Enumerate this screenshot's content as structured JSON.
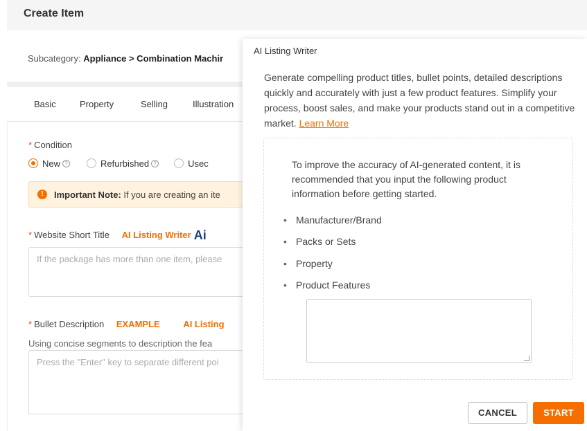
{
  "page": {
    "title": "Create Item",
    "subcategory_label": "Subcategory:",
    "subcategory_value": "Appliance > Combination Machir"
  },
  "tabs": [
    "Basic",
    "Property",
    "Selling",
    "Illustration"
  ],
  "form": {
    "condition": {
      "label": "Condition",
      "options": [
        "New",
        "Refurbished",
        "Usec"
      ],
      "selected": "New"
    },
    "note": {
      "bold": "Important Note:",
      "text": " If you are creating an ite"
    },
    "short_title": {
      "label": "Website Short Title",
      "ai_link": "AI Listing Writer",
      "ai_badge": "Ai",
      "placeholder": "If the package has more than one item, please"
    },
    "bullet": {
      "label": "Bullet Description",
      "example": "EXAMPLE",
      "ai_link": "AI Listing",
      "hint": "Using concise segments to description the fea",
      "placeholder": "Press the \"Enter\" key to separate different poi"
    }
  },
  "modal": {
    "title": "AI Listing Writer",
    "description": "Generate compelling product titles, bullet points, detailed descriptions quickly and accurately with just a few product features. Simplify your process, boost sales, and make your products stand out in a competitive market.",
    "learn_more": "Learn More",
    "info": "To improve the accuracy of AI-generated content, it is recommended that you input the following product information before getting started.",
    "bullets": [
      "Manufacturer/Brand",
      "Packs or Sets",
      "Property",
      "Product Features"
    ],
    "features_value": "",
    "cancel": "CANCEL",
    "start": "START"
  },
  "colors": {
    "accent": "#f56f00",
    "ai_badge": "#1a3d7c",
    "note_bg": "#fff3e0"
  }
}
